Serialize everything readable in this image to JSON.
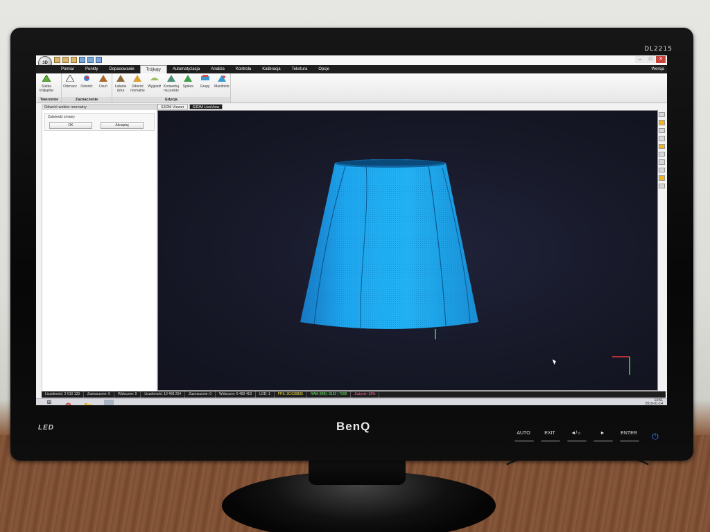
{
  "monitor": {
    "model": "DL2215",
    "brand": "BenQ",
    "led_label": "LED",
    "buttons": [
      "AUTO",
      "EXIT",
      "◄/☼",
      "►",
      "ENTER"
    ],
    "power_icon": "power-icon"
  },
  "app": {
    "logo_text": "3D",
    "window_controls": [
      "–",
      "□",
      "✕"
    ],
    "menu_tabs": [
      "Pomiar",
      "Punkty",
      "Dopasowanie",
      "Trójkąty",
      "Automatyzacja",
      "Analiza",
      "Kontrola",
      "Kalibracja",
      "Tekstura",
      "Opcje"
    ],
    "active_tab_index": 3,
    "help_label": "Wersja",
    "ribbon": {
      "groups": [
        {
          "label": "Tworzenie",
          "items": [
            "Siatka trójkątów"
          ]
        },
        {
          "label": "Zaznaczenie",
          "items": [
            "Odznacz",
            "Odwróć",
            "Usuń"
          ]
        },
        {
          "label": "Edycja",
          "items": [
            "Łatanie dziur",
            "Odwróć normalne",
            "Wygładź",
            "Konwertuj na punkty",
            "Spikes",
            "Grupy",
            "Manifolds"
          ]
        }
      ]
    },
    "side_panel": {
      "title": "Odwróć wektor normalny",
      "section_label": "Zatwierdź zmiany",
      "ok_button": "OK",
      "accept_button": "Akceptuj"
    },
    "viewer_tabs": [
      "S3DM Viewer",
      "S3DM LiveView"
    ],
    "status": {
      "points_count": "Liczebność: 2 610 133",
      "selected_1": "Zaznaczone: 0",
      "visible_1": "Widoczne: 0",
      "triangles_count": "Liczebność: 10 468 254",
      "selected_2": "Zaznaczone: 0",
      "visible_2": "Widoczne: 6 489 418",
      "lod": "LOD: 1",
      "fps": "FPS: 20.639835",
      "ram": "RAM (MB): 8152 | 7090",
      "ram2": "Zużycie: 18%"
    }
  },
  "taskbar": {
    "time": "13:51",
    "date": "2019-01-14"
  },
  "colors": {
    "model_blue": "#1aa0ea",
    "viewport_bg": "#171a2b",
    "status_fps": "#f0e24a",
    "status_ram": "#6df06b"
  }
}
